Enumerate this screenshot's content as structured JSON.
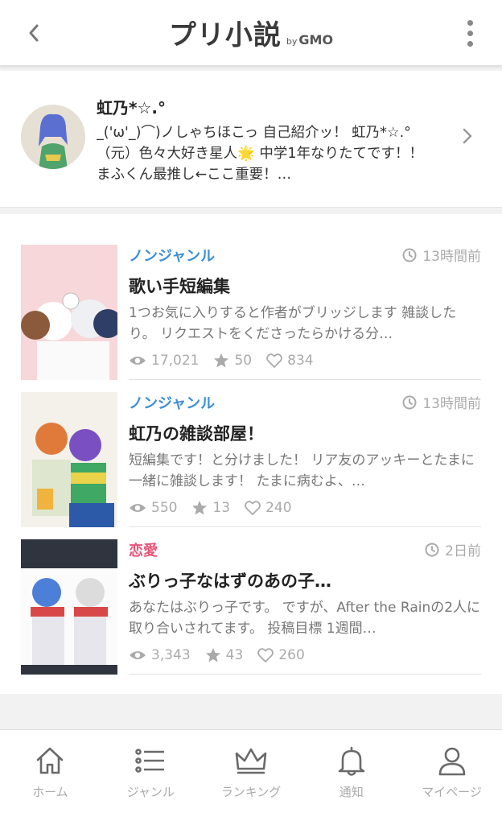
{
  "header": {
    "logo_main": "プリ小説",
    "logo_by": "by",
    "logo_brand": "GMO",
    "back_icon": "chevron-left-icon",
    "menu_icon": "more-vertical-icon"
  },
  "profile": {
    "name": "虹乃*☆.°",
    "bio": "_('ω'_)⌒)ノしゃちほこっ 自己紹介ッ！ 虹乃*☆.°（元）色々大好き星人🌟 中学1年なりたてです！！ まふくん最推し←ここ重要！…",
    "chevron_icon": "chevron-right-icon"
  },
  "novels": [
    {
      "genre": "ノンジャンル",
      "genre_color": "#3d8fd6",
      "time": "13時間前",
      "title": "歌い手短編集",
      "desc": "1つお気に入りすると作者がブリッジします 雑談したり。 リクエストをくださったらかける分…",
      "views": "17,021",
      "stars": "50",
      "likes": "834"
    },
    {
      "genre": "ノンジャンル",
      "genre_color": "#3d8fd6",
      "time": "13時間前",
      "title": "虹乃の雑談部屋！",
      "desc": "短編集です！と分けました！ リア友のアッキーとたまに一緒に雑談します！ たまに病むよ、…",
      "views": "550",
      "stars": "13",
      "likes": "240"
    },
    {
      "genre": "恋愛",
      "genre_color": "#e9547a",
      "time": "2日前",
      "title": "ぶりっ子なはずのあの子…",
      "desc": "あなたはぶりっ子です。 ですが、After the Rainの2人に取り合いされてます。 投稿目標 1週間…",
      "views": "3,343",
      "stars": "43",
      "likes": "260"
    }
  ],
  "tabs": [
    {
      "label": "ホーム",
      "icon": "home-icon"
    },
    {
      "label": "ジャンル",
      "icon": "list-icon"
    },
    {
      "label": "ランキング",
      "icon": "crown-icon"
    },
    {
      "label": "通知",
      "icon": "bell-icon"
    },
    {
      "label": "マイページ",
      "icon": "user-icon"
    }
  ],
  "colors": {
    "accent_pink": "#e9547a",
    "genre_blue": "#3d8fd6",
    "muted": "#aaaaaa"
  }
}
